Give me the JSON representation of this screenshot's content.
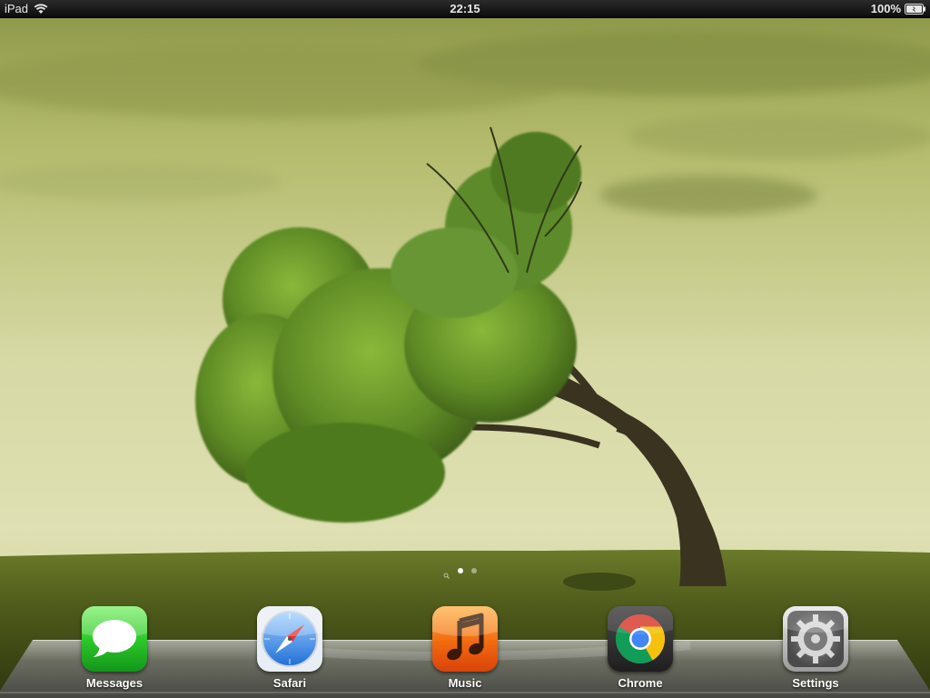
{
  "status_bar": {
    "device": "iPad",
    "time": "22:15",
    "battery": "100%"
  },
  "page_indicator": {
    "pages": 2,
    "current": 1,
    "has_spotlight": true
  },
  "dock": {
    "apps": [
      {
        "label": "Messages",
        "icon": "messages-icon",
        "color": "#2ecc2e"
      },
      {
        "label": "Safari",
        "icon": "safari-compass-icon",
        "color": "#3a8ee6"
      },
      {
        "label": "Music",
        "icon": "music-note-icon",
        "color": "#f06a10"
      },
      {
        "label": "Chrome",
        "icon": "chrome-logo-icon",
        "color": "#3a3a3a"
      },
      {
        "label": "Settings",
        "icon": "gear-icon",
        "color": "#8a8a8a"
      }
    ]
  },
  "colors": {
    "sky": "#c9cf8a",
    "grass": "#4f5a1c",
    "tree": "#5d8a2a"
  }
}
